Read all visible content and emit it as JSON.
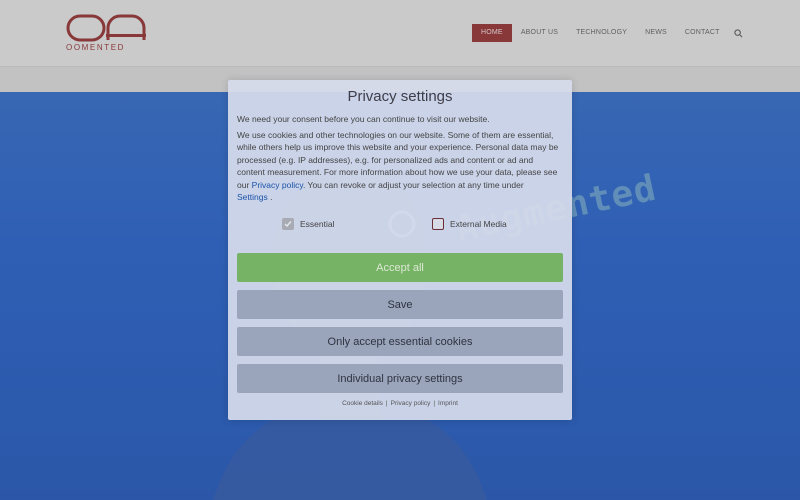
{
  "header": {
    "logo_text": "OOMENTED",
    "nav": [
      {
        "label": "HOME",
        "active": true
      },
      {
        "label": "ABOUT US",
        "active": false
      },
      {
        "label": "TECHNOLOGY",
        "active": false
      },
      {
        "label": "NEWS",
        "active": false
      },
      {
        "label": "CONTACT",
        "active": false
      }
    ],
    "search_icon": "search-icon"
  },
  "hero": {
    "title": "Augmented"
  },
  "modal": {
    "title": "Privacy settings",
    "intro": "We need your consent before you can continue to visit our website.",
    "body_part1": "We use cookies and other technologies on our website. Some of them are essential, while others help us improve this website and your experience. Personal data may be processed (e.g. IP addresses), e.g. for personalized ads and content or ad and content measurement. For more information about how we use your data, please see our ",
    "body_link1": "Privacy policy",
    "body_part2": ". You can revoke or adjust your selection at any time under ",
    "body_link2": "Settings",
    "body_part3": " .",
    "checks": {
      "essential": {
        "label": "Essential",
        "checked": true
      },
      "external": {
        "label": "External Media",
        "checked": false
      }
    },
    "buttons": {
      "accept_all": "Accept all",
      "save": "Save",
      "only_essential": "Only accept essential cookies",
      "individual": "Individual privacy settings"
    },
    "footer": {
      "cookie_details": "Cookie details",
      "privacy_policy": "Privacy policy",
      "imprint": "Imprint",
      "separator": "|"
    }
  },
  "colors": {
    "brand": "#8b2a2a",
    "accept": "#77b365",
    "hero_blue": "#1e59c0"
  }
}
